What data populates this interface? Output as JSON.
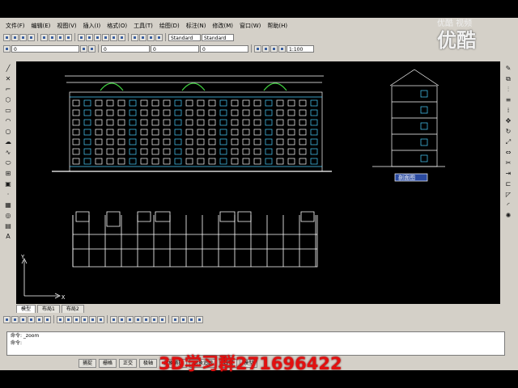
{
  "menu": {
    "items": [
      "文件(F)",
      "编辑(E)",
      "视图(V)",
      "插入(I)",
      "格式(O)",
      "工具(T)",
      "绘图(D)",
      "标注(N)",
      "修改(M)",
      "窗口(W)",
      "帮助(H)"
    ]
  },
  "toolbar": {
    "layer_combo": "0",
    "style_combo": "Standard",
    "scale_combo": "1:100"
  },
  "layout_tabs": [
    "模型",
    "布局1",
    "布局2"
  ],
  "active_tab_index": 0,
  "viewport": {
    "section_label": "剖面图"
  },
  "command": {
    "line1": "命令: _zoom",
    "line2": "命令:"
  },
  "status": {
    "coords": "",
    "buttons": [
      "捕捉",
      "栅格",
      "正交",
      "极轴",
      "对象捕捉",
      "对象追踪",
      "线宽",
      "模型"
    ]
  },
  "overlay": {
    "qq_text": "3D学习群271696422",
    "watermark_small": "优酷 视频",
    "watermark_big": "优酷"
  },
  "colors": {
    "app_bg": "#d4d0c8",
    "canvas_bg": "#000000",
    "overlay_red": "#e21010"
  }
}
